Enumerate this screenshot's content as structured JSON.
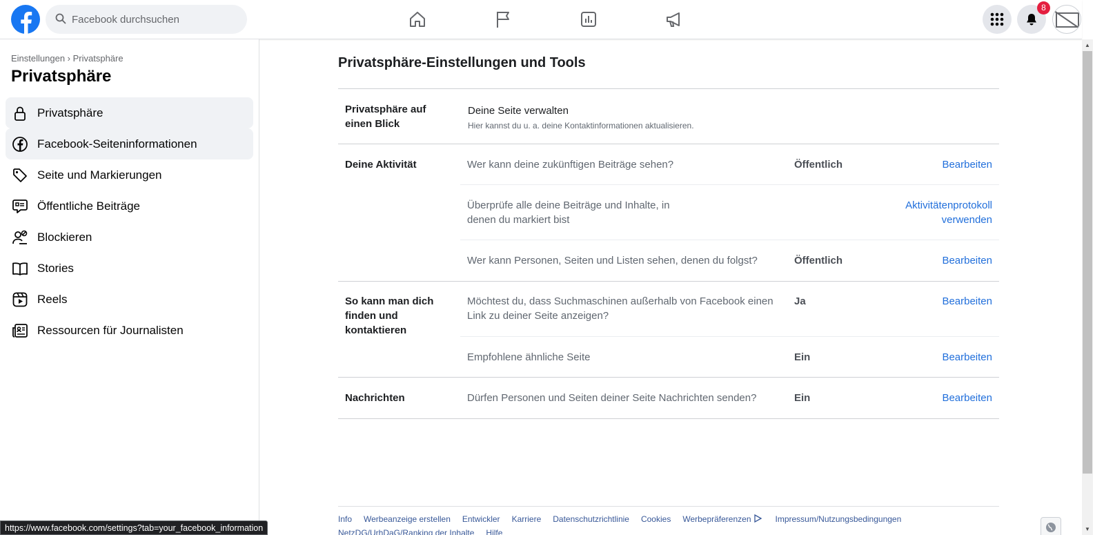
{
  "header": {
    "search_placeholder": "Facebook durchsuchen",
    "notifications_count": "8",
    "brand_color": "#1877f2"
  },
  "icons": {
    "nav": [
      "home-icon",
      "flag-icon",
      "chart-icon",
      "megaphone-icon"
    ],
    "menu": "grid-menu-icon",
    "notifications": "bell-icon"
  },
  "sidebar": {
    "breadcrumb": "Einstellungen › Privatsphäre",
    "title": "Privatsphäre",
    "items": [
      {
        "label": "Privatsphäre",
        "icon": "lock-icon",
        "active": true
      },
      {
        "label": "Facebook-Seiteninformationen",
        "icon": "facebook-icon",
        "active": true
      },
      {
        "label": "Seite und Markierungen",
        "icon": "tag-icon",
        "active": false
      },
      {
        "label": "Öffentliche Beiträge",
        "icon": "speech-bubble-icon",
        "active": false
      },
      {
        "label": "Blockieren",
        "icon": "block-user-icon",
        "active": false
      },
      {
        "label": "Stories",
        "icon": "book-icon",
        "active": false
      },
      {
        "label": "Reels",
        "icon": "reels-icon",
        "active": false
      },
      {
        "label": "Ressourcen für Journalisten",
        "icon": "newspaper-icon",
        "active": false
      }
    ]
  },
  "main": {
    "title": "Privatsphäre-Einstellungen und Tools",
    "sections": {
      "glance": {
        "label": "Privatsphäre auf einen Blick",
        "heading": "Deine Seite verwalten",
        "sub": "Hier kannst du u. a. deine Kontaktinformationen aktualisieren."
      },
      "activity": {
        "label": "Deine Aktivität",
        "rows": [
          {
            "question": "Wer kann deine zukünftigen Beiträge sehen?",
            "value": "Öffentlich",
            "action": "Bearbeiten"
          },
          {
            "question": "Überprüfe alle deine Beiträge und Inhalte, in denen du markiert bist",
            "value": "",
            "action": "Aktivitätenprotokoll verwenden"
          },
          {
            "question": "Wer kann Personen, Seiten und Listen sehen, denen du folgst?",
            "value": "Öffentlich",
            "action": "Bearbeiten"
          }
        ]
      },
      "find": {
        "label": "So kann man dich finden und kontaktieren",
        "rows": [
          {
            "question": "Möchtest du, dass Suchmaschinen außerhalb von Facebook einen Link zu deiner Seite anzeigen?",
            "value": "Ja",
            "action": "Bearbeiten"
          },
          {
            "question": "Empfohlene ähnliche Seite",
            "value": "Ein",
            "action": "Bearbeiten"
          }
        ]
      },
      "messages": {
        "label": "Nachrichten",
        "rows": [
          {
            "question": "Dürfen Personen und Seiten deiner Seite Nachrichten senden?",
            "value": "Ein",
            "action": "Bearbeiten"
          }
        ]
      }
    }
  },
  "footer": {
    "links": [
      "Info",
      "Werbeanzeige erstellen",
      "Entwickler",
      "Karriere",
      "Datenschutzrichtlinie",
      "Cookies",
      "Werbepräferenzen",
      "Impressum/Nutzungsbedingungen"
    ],
    "links_row2": [
      "NetzDG/UrhDaG/Ranking der Inhalte",
      "Hilfe"
    ]
  },
  "status_url": "https://www.facebook.com/settings?tab=your_facebook_information"
}
